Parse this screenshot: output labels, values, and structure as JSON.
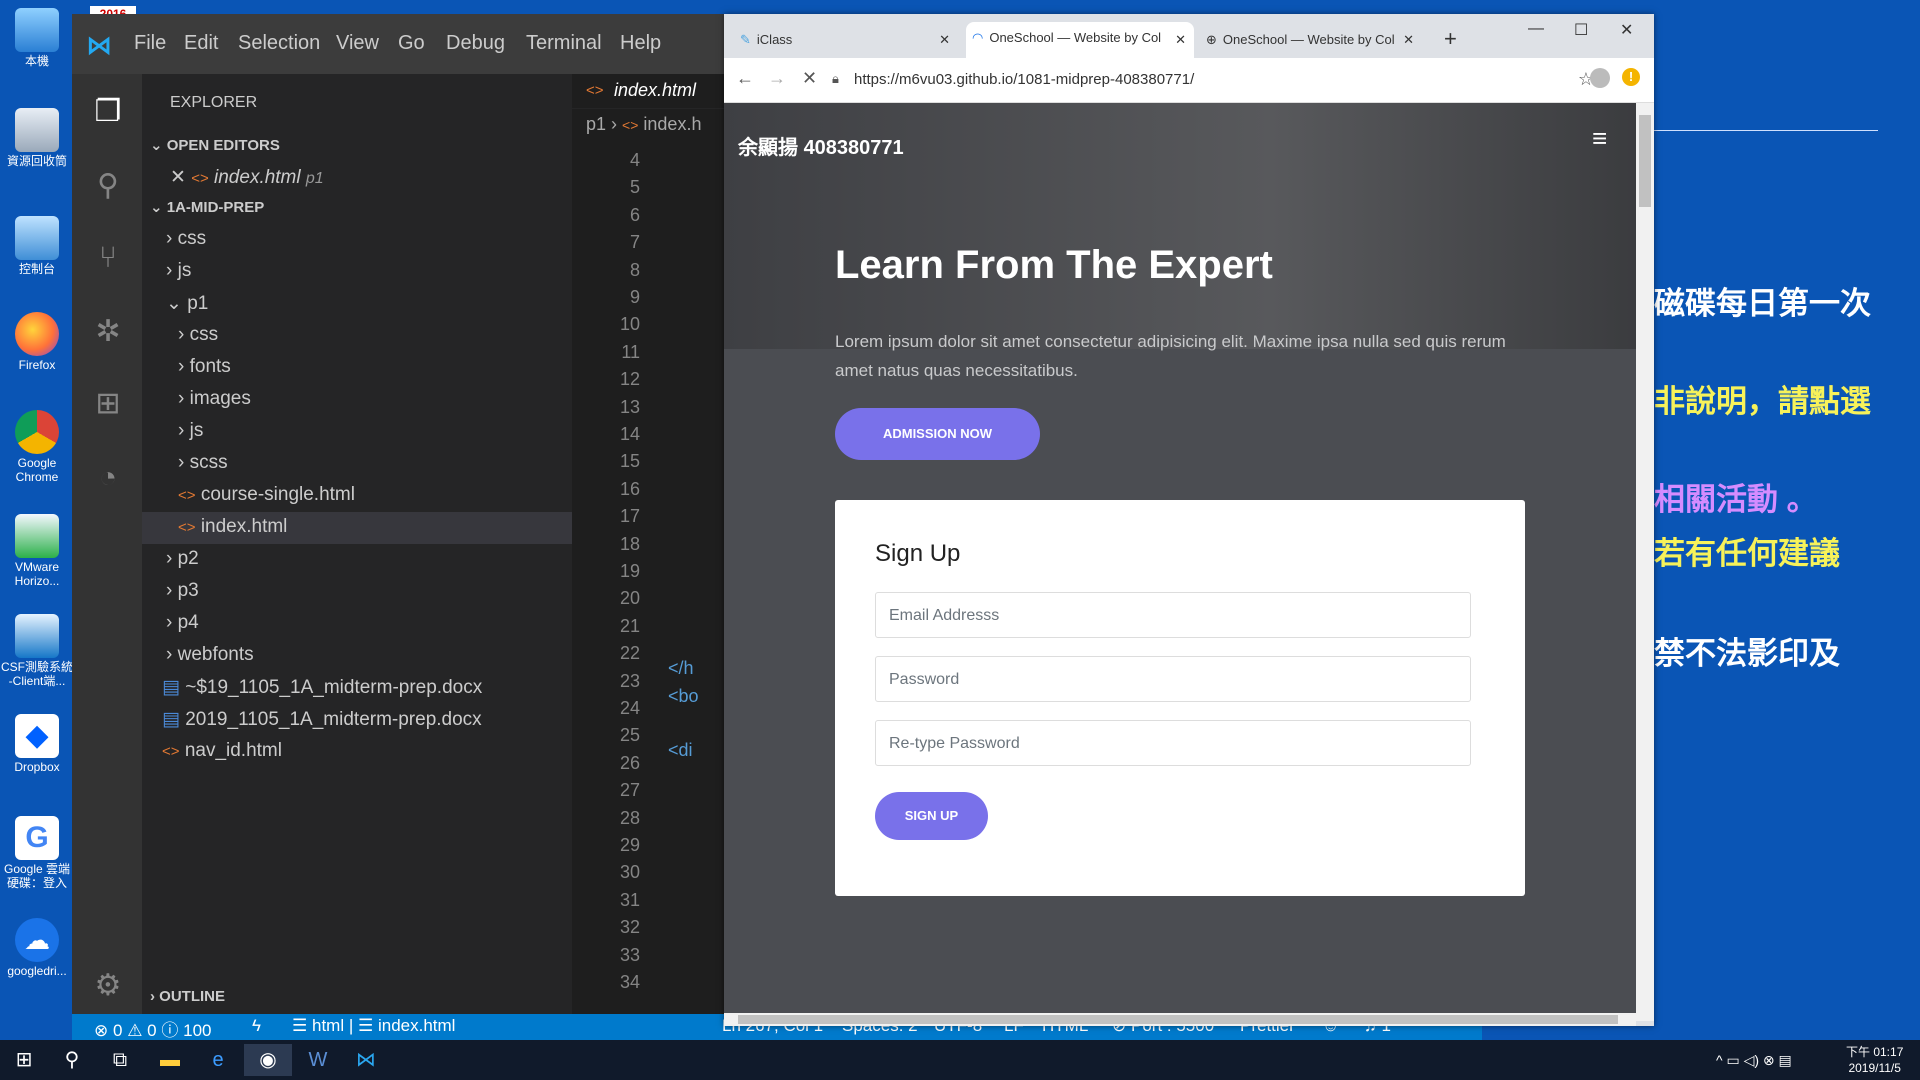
{
  "desktop": {
    "badge": "2016",
    "icons": [
      {
        "label": "本機"
      },
      {
        "label": "資源回收筒"
      },
      {
        "label": "控制台"
      },
      {
        "label": "Firefox"
      },
      {
        "label": "Google Chrome"
      },
      {
        "label": "VMware Horizo..."
      },
      {
        "label": "CSF測驗系統 -Client端..."
      },
      {
        "label": "Dropbox"
      },
      {
        "label": "Google 雲端 硬碟：登入"
      },
      {
        "label": "googledri..."
      }
    ]
  },
  "vscode": {
    "menu": [
      "File",
      "Edit",
      "Selection",
      "View",
      "Go",
      "Debug",
      "Terminal",
      "Help"
    ],
    "explorer_title": "EXPLORER",
    "open_editors": "OPEN EDITORS",
    "open_file": "index.html",
    "open_file_dir": "p1",
    "project": "1A-MID-PREP",
    "tree": {
      "css": "css",
      "js": "js",
      "p1": "p1",
      "p1_css": "css",
      "p1_fonts": "fonts",
      "p1_images": "images",
      "p1_js": "js",
      "p1_scss": "scss",
      "course": "course-single.html",
      "index": "index.html",
      "p2": "p2",
      "p3": "p3",
      "p4": "p4",
      "webfonts": "webfonts",
      "doc1": "~$19_1105_1A_midterm-prep.docx",
      "doc2": "2019_1105_1A_midterm-prep.docx",
      "nav": "nav_id.html"
    },
    "outline": "OUTLINE",
    "tab_label": "index.html",
    "breadcrumb": {
      "dir": "p1",
      "file": "index.h"
    },
    "line_numbers": [
      "4",
      "5",
      "6",
      "7",
      "8",
      "9",
      "10",
      "11",
      "12",
      "13",
      "14",
      "15",
      "16",
      "17",
      "18",
      "19",
      "20",
      "21",
      "22",
      "23",
      "24",
      "25",
      "26",
      "27",
      "28",
      "29",
      "30",
      "31",
      "32",
      "33",
      "34"
    ],
    "code_snips": {
      "l28": "</h",
      "l29": "<bo",
      "l31": "<di"
    },
    "status": {
      "errors": "0",
      "warnings": "0",
      "info": "100",
      "lang1": "html",
      "sep": "|",
      "lang2": "index.html",
      "position": "Ln 267, Col 1",
      "spaces": "Spaces: 2",
      "encoding": "UTF-8",
      "eol": "LF",
      "mode": "HTML",
      "port": "Port : 5500",
      "prettier": "Prettier",
      "bell": "1"
    }
  },
  "chrome": {
    "tabs": [
      {
        "title": "iClass"
      },
      {
        "title": "OneSchool — Website by Col"
      },
      {
        "title": "OneSchool — Website by Col"
      }
    ],
    "url": "https://m6vu03.github.io/1081-midprep-408380771/",
    "site": {
      "brand_name": "余顯揚",
      "brand_id": "408380771",
      "hero_title": "Learn From The Expert",
      "hero_text": "Lorem ipsum dolor sit amet consectetur adipisicing elit. Maxime ipsa nulla sed quis rerum amet natus quas necessitatibus.",
      "admission_btn": "ADMISSION NOW",
      "form_title": "Sign Up",
      "email_ph": "Email Addresss",
      "password_ph": "Password",
      "retype_ph": "Re-type Password",
      "signup_btn": "SIGN UP"
    }
  },
  "doc": {
    "lines": [
      "磁碟每日第一次",
      "非說明，請點選",
      "相關活動 。",
      "若有任何建議",
      "禁不法影印及"
    ]
  },
  "taskbar": {
    "time": "下午 01:17",
    "date": "2019/11/5"
  }
}
